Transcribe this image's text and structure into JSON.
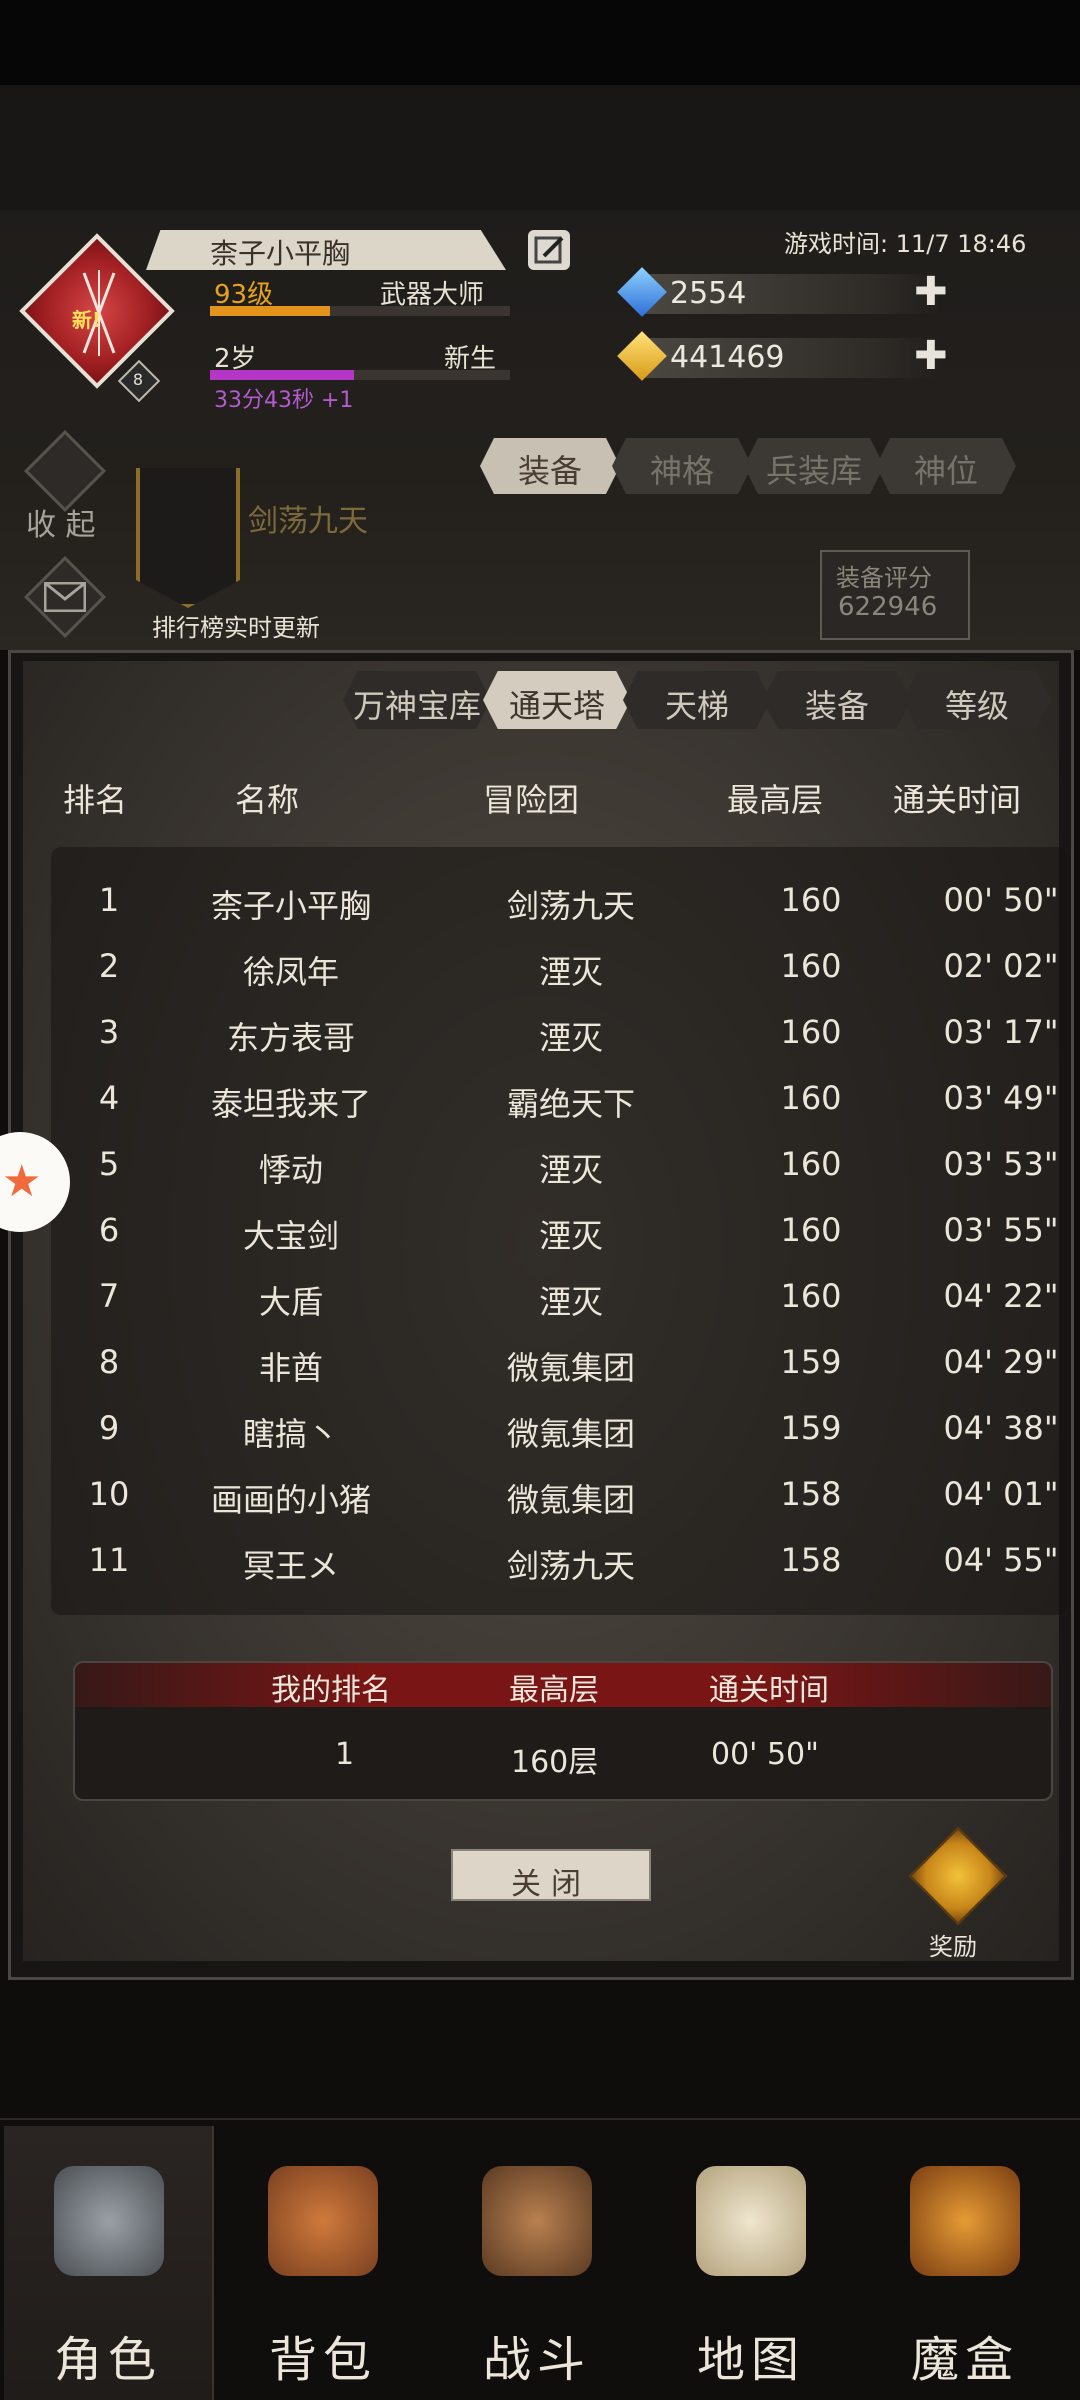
{
  "player": {
    "name": "柰子小平胸",
    "new_tag": "新!",
    "badge_level": "8",
    "level": "93级",
    "title": "武器大师",
    "age": "2岁",
    "age_title": "新生",
    "timer": "33分43秒 +1",
    "xp_progress": 0.4,
    "age_progress": 0.48
  },
  "game_time": "游戏时间: 11/7 18:46",
  "currencies": [
    {
      "icon": "blue-gem-icon",
      "value": "2554"
    },
    {
      "icon": "gold-gem-icon",
      "value": "441469"
    }
  ],
  "side": {
    "collapse_label": "收 起"
  },
  "guild": {
    "name": "剑荡九天",
    "rank_notice": "排行榜实时更新"
  },
  "main_tabs": [
    "装备",
    "神格",
    "兵装库",
    "神位"
  ],
  "score": {
    "label": "装备评分",
    "value": "622946"
  },
  "ranking": {
    "tabs": [
      "万神宝库",
      "通天塔",
      "天梯",
      "装备",
      "等级"
    ],
    "active_tab": 1,
    "columns": [
      "排名",
      "名称",
      "冒险团",
      "最高层",
      "通关时间"
    ],
    "rows": [
      [
        "1",
        "柰子小平胸",
        "剑荡九天",
        "160",
        "00' 50\""
      ],
      [
        "2",
        "徐凤年",
        "湮灭",
        "160",
        "02' 02\""
      ],
      [
        "3",
        "东方表哥",
        "湮灭",
        "160",
        "03' 17\""
      ],
      [
        "4",
        "泰坦我来了",
        "霸绝天下",
        "160",
        "03' 49\""
      ],
      [
        "5",
        "悸动",
        "湮灭",
        "160",
        "03' 53\""
      ],
      [
        "6",
        "大宝剑",
        "湮灭",
        "160",
        "03' 55\""
      ],
      [
        "7",
        "大盾",
        "湮灭",
        "160",
        "04' 22\""
      ],
      [
        "8",
        "非酋",
        "微氪集团",
        "159",
        "04' 29\""
      ],
      [
        "9",
        "瞎搞丶",
        "微氪集团",
        "159",
        "04' 38\""
      ],
      [
        "10",
        "画画的小猪",
        "微氪集团",
        "158",
        "04' 01\""
      ],
      [
        "11",
        "冥王メ",
        "剑荡九天",
        "158",
        "04' 55\""
      ]
    ],
    "my_rank": {
      "headers": [
        "我的排名",
        "最高层",
        "通关时间"
      ],
      "values": [
        "1",
        "160层",
        "00' 50\""
      ]
    },
    "close_label": "关闭",
    "reward_label": "奖励"
  },
  "bottom_nav": [
    {
      "label": "角色",
      "icon": "helmet-icon",
      "active": true
    },
    {
      "label": "背包",
      "icon": "backpack-icon",
      "active": false
    },
    {
      "label": "战斗",
      "icon": "sword-shield-icon",
      "active": false
    },
    {
      "label": "地图",
      "icon": "scroll-map-icon",
      "active": false
    },
    {
      "label": "魔盒",
      "icon": "magic-box-icon",
      "active": false
    }
  ],
  "colors": {
    "accent_red": "#a11f22",
    "gold": "#e2951a",
    "purple": "#b535c6"
  }
}
